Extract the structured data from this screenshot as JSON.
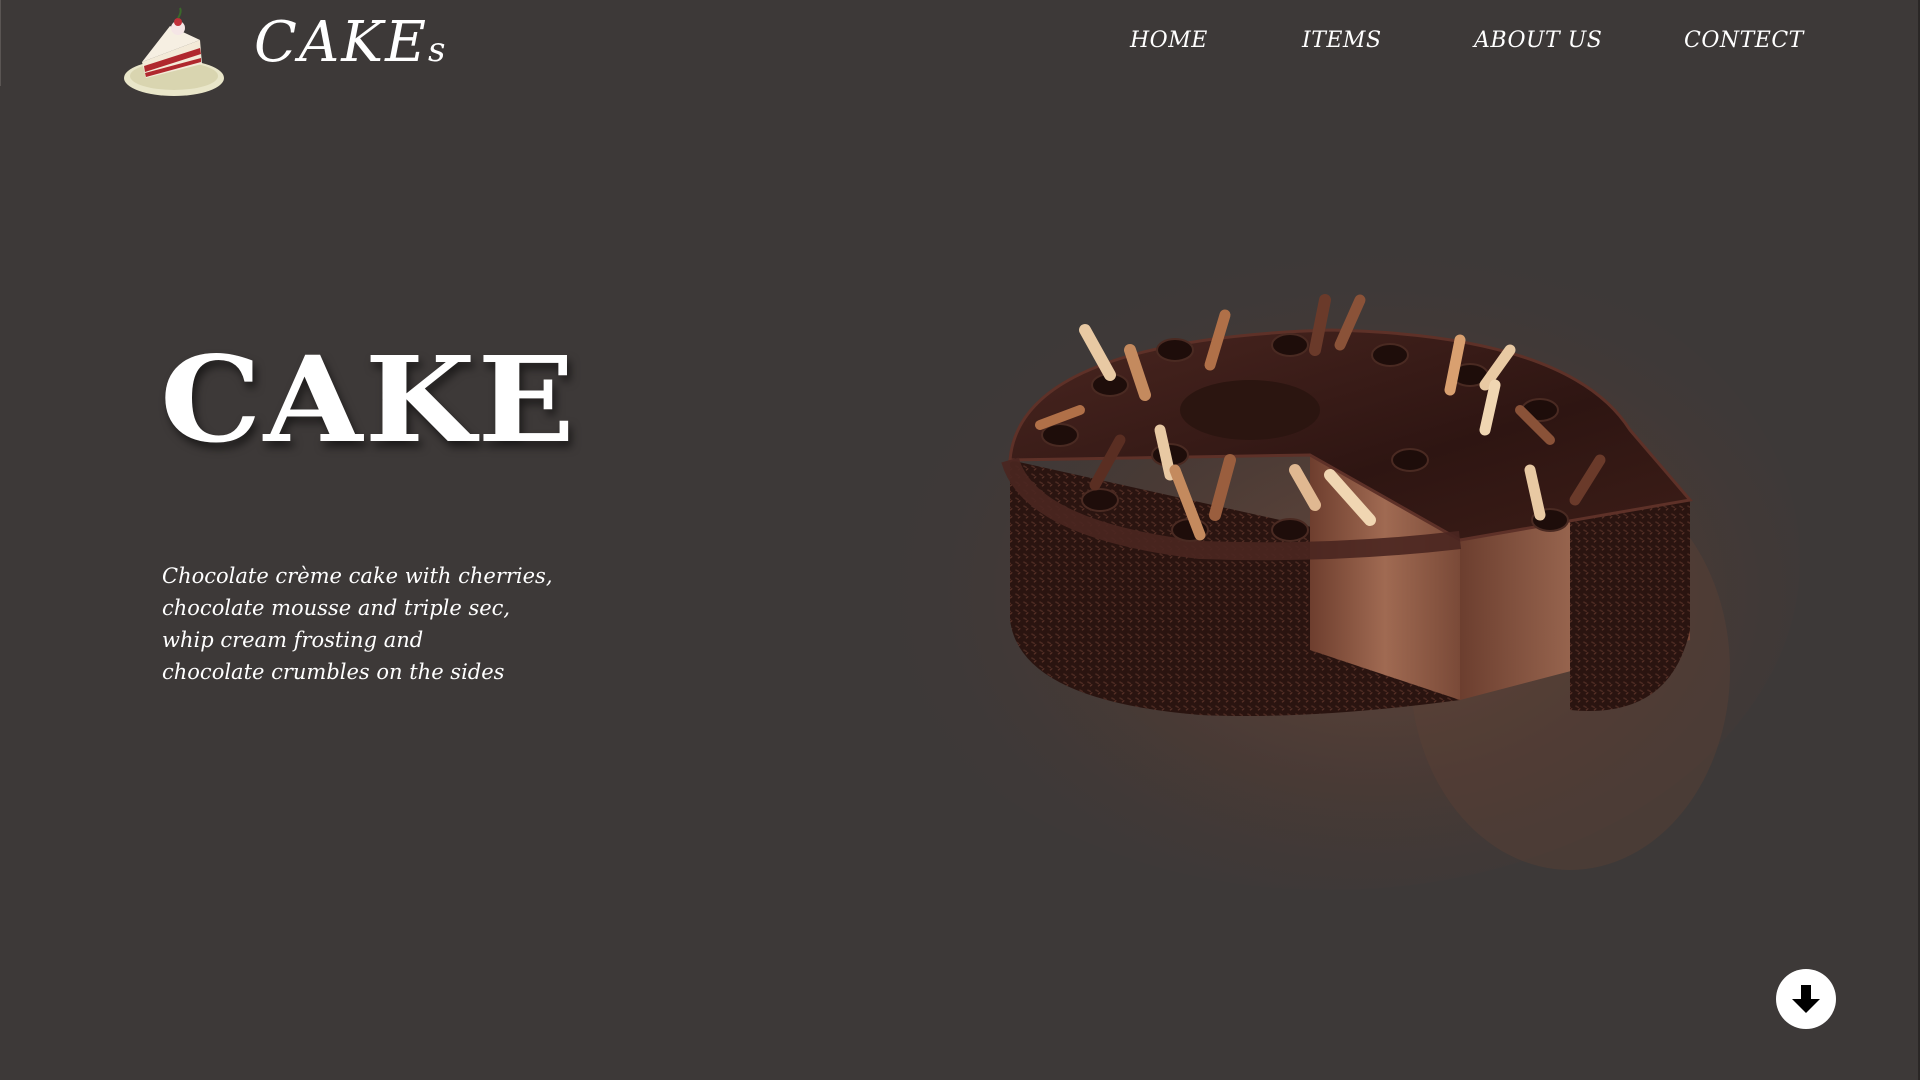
{
  "header": {
    "brand_main": "CAKE",
    "brand_small": "s",
    "logo_icon": "cake-slice-icon"
  },
  "nav": {
    "items": [
      {
        "label": "HOME"
      },
      {
        "label": "ITEMS"
      },
      {
        "label": "ABOUT US"
      },
      {
        "label": "CONTECT"
      }
    ]
  },
  "hero": {
    "title": "CAKE",
    "description_lines": [
      "Chocolate crème cake with cherries,",
      "chocolate mousse and triple sec,",
      "whip cream frosting and",
      "chocolate crumbles on the sides"
    ],
    "image_icon": "chocolate-cake-image"
  },
  "scroll_button": {
    "icon": "arrow-down-icon"
  },
  "colors": {
    "background": "#3d3938",
    "text": "#ffffff",
    "chocolate_dark": "#2a1612",
    "chocolate_mid": "#4a2a22",
    "sponge": "#8a5a48",
    "curl_light": "#e8c9a3"
  }
}
